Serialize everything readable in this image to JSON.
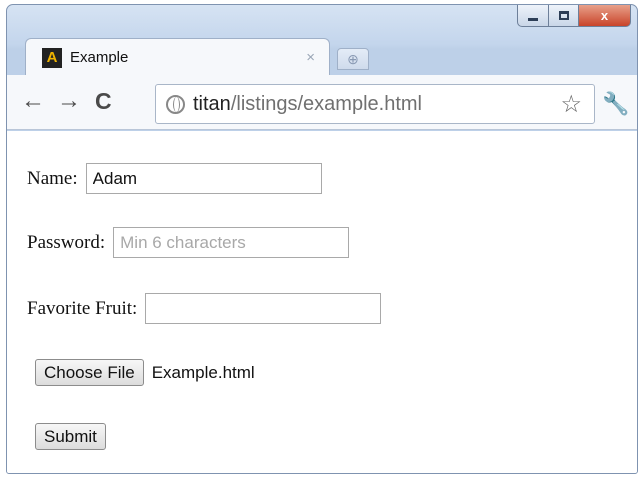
{
  "window": {
    "minimize_icon": "minimize-icon",
    "maximize_icon": "maximize-icon",
    "close_label": "x"
  },
  "tab": {
    "favicon_letter": "A",
    "title": "Example",
    "close_label": "×",
    "new_tab_icon": "new-tab-icon"
  },
  "toolbar": {
    "back_label": "←",
    "forward_label": "→",
    "reload_label": "C",
    "url_host": "titan",
    "url_path": "/listings/example.html",
    "star_label": "☆",
    "wrench_label": "🔧"
  },
  "form": {
    "name_label": "Name:",
    "name_value": "Adam",
    "password_label": "Password:",
    "password_placeholder": "Min 6 characters",
    "fruit_label": "Favorite Fruit:",
    "fruit_value": "",
    "choose_file_label": "Choose File",
    "file_name": "Example.html",
    "submit_label": "Submit"
  }
}
